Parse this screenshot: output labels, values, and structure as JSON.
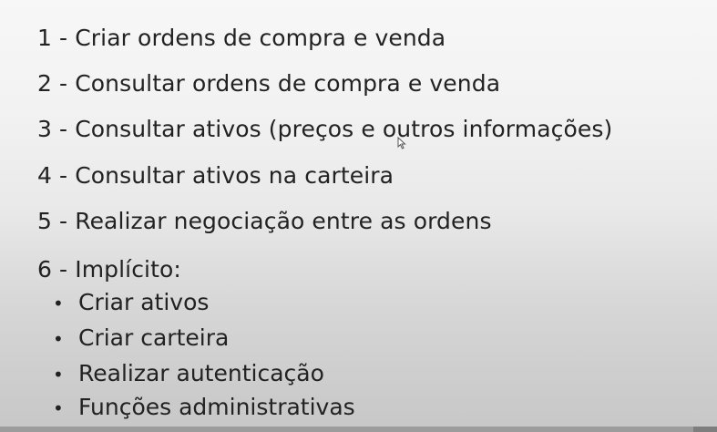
{
  "items": [
    {
      "label": "1 - Criar ordens de compra e venda"
    },
    {
      "label": "2 - Consultar ordens de compra e venda"
    },
    {
      "label": "3 - Consultar ativos (preços e outros informações)"
    },
    {
      "label": "4 - Consultar ativos na carteira"
    },
    {
      "label": "5 - Realizar negociação entre as ordens"
    },
    {
      "label": "6 - Implícito:"
    }
  ],
  "sub_items": [
    {
      "bullet": "•",
      "label": "Criar ativos"
    },
    {
      "bullet": "•",
      "label": "Criar carteira"
    },
    {
      "bullet": "•",
      "label": "Realizar autenticação"
    },
    {
      "bullet": "•",
      "label": "Funções administrativas"
    }
  ],
  "colors": {
    "text": "#222222",
    "background_top": "#f7f7f7",
    "background_bottom": "#c7c7c7"
  },
  "icons": {
    "cursor": "mouse-pointer-icon"
  }
}
